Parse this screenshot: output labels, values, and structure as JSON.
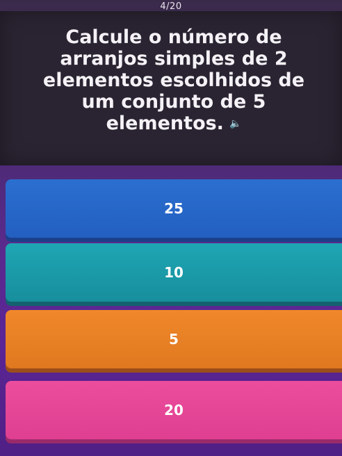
{
  "progress": "4/20",
  "question": {
    "text": "Calcule o número de arranjos simples de 2 elementos escolhidos de um conjunto de 5 elementos.",
    "speaker_icon": "speaker-icon"
  },
  "answers": [
    {
      "label": "25",
      "color": "#2a6fd0"
    },
    {
      "label": "10",
      "color": "#1fa6b4"
    },
    {
      "label": "5",
      "color": "#f0882a"
    },
    {
      "label": "20",
      "color": "#ec4d9c"
    }
  ]
}
